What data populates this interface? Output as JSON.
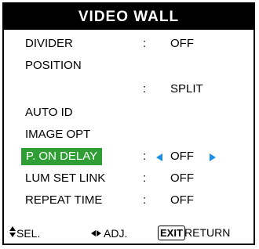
{
  "menu": {
    "title": "VIDEO WALL",
    "rows": [
      {
        "label": "DIVIDER",
        "colon": ":",
        "value": "OFF"
      },
      {
        "label": "POSITION",
        "colon": "",
        "value": ""
      },
      {
        "label": "",
        "colon": ":",
        "value": "SPLIT"
      },
      {
        "label": "AUTO ID",
        "colon": "",
        "value": ""
      },
      {
        "label": "IMAGE OPT",
        "colon": "",
        "value": ""
      },
      {
        "label": "P. ON DELAY",
        "colon": ":",
        "value": "OFF",
        "selected": true
      },
      {
        "label": "LUM SET LINK",
        "colon": ":",
        "value": "OFF"
      },
      {
        "label": "REPEAT TIME",
        "colon": ":",
        "value": "OFF"
      }
    ],
    "highlight_color": "#2e9e35",
    "arrow_color": "#1a8fe3"
  },
  "footer": {
    "sel_label": "SEL.",
    "adj_label": "ADJ.",
    "exit_key": "EXIT",
    "return_label": "RETURN"
  }
}
